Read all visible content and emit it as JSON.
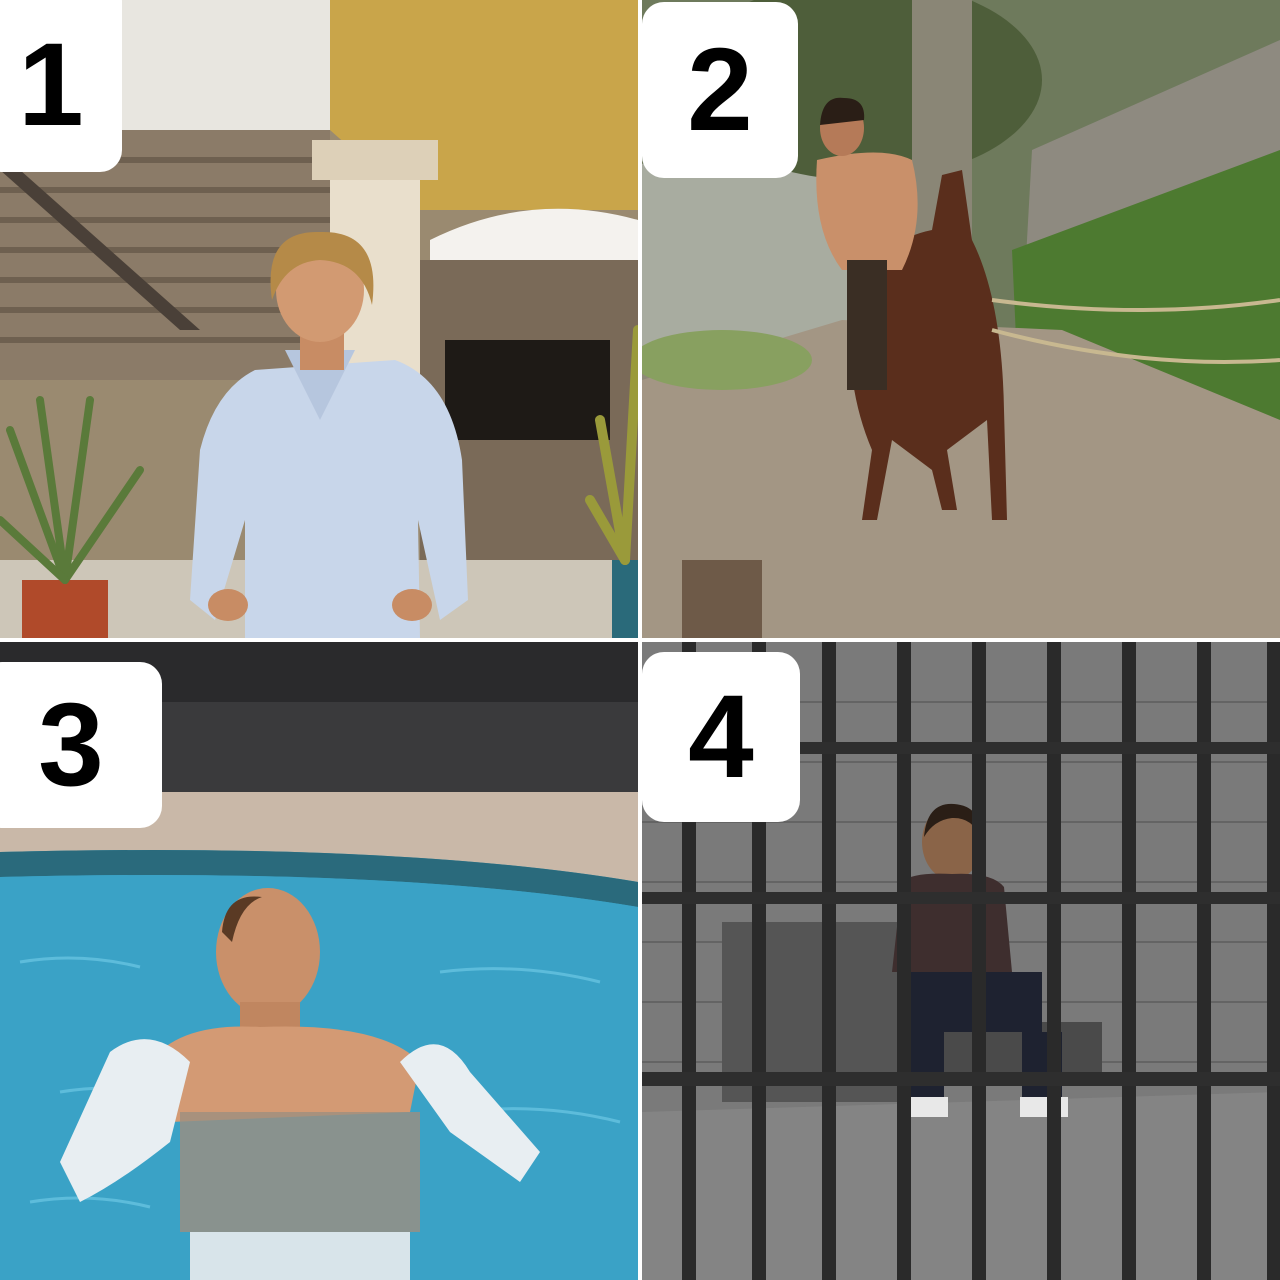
{
  "panels": [
    {
      "id": "panel-1",
      "number": "1",
      "scene": "man-in-light-blue-shirt-on-patio"
    },
    {
      "id": "panel-2",
      "number": "2",
      "scene": "shirtless-man-riding-horse-on-dirt-trail"
    },
    {
      "id": "panel-3",
      "number": "3",
      "scene": "man-in-wet-white-shirt-in-swimming-pool"
    },
    {
      "id": "panel-4",
      "number": "4",
      "scene": "man-sitting-behind-jail-cell-bars"
    }
  ],
  "colors": {
    "badge_background": "#ffffff",
    "badge_text": "#000000",
    "pool_water": "#3a9fc0",
    "jail_gray": "#5a5a5a"
  }
}
